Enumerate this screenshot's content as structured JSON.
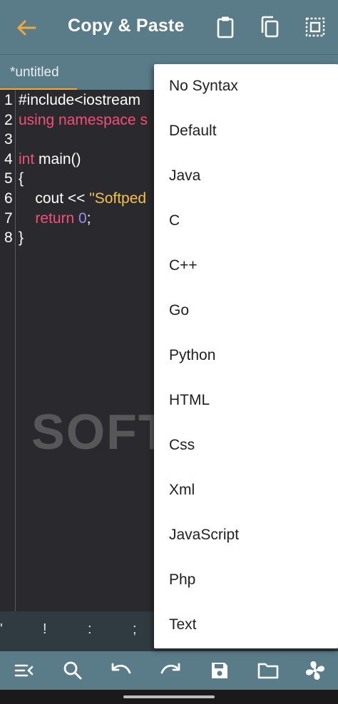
{
  "toolbar": {
    "title": "Copy & Paste",
    "icons": [
      "back-arrow-icon",
      "clipboard-icon",
      "copy-icon",
      "select-all-icon"
    ],
    "accent": "#f2a93b",
    "background": "#5a7c88"
  },
  "tab": {
    "label": "*untitled"
  },
  "editor": {
    "lines": [
      {
        "n": "1",
        "parts": [
          {
            "t": "#include<iostream",
            "c": "plain"
          }
        ]
      },
      {
        "n": "2",
        "parts": [
          {
            "t": "using namespace s",
            "c": "kw"
          }
        ]
      },
      {
        "n": "3",
        "parts": []
      },
      {
        "n": "4",
        "parts": [
          {
            "t": "int",
            "c": "kw"
          },
          {
            "t": " main()",
            "c": "plain"
          }
        ]
      },
      {
        "n": "5",
        "parts": [
          {
            "t": "{",
            "c": "plain"
          }
        ]
      },
      {
        "n": "6",
        "parts": [
          {
            "t": "    cout << ",
            "c": "plain"
          },
          {
            "t": "\"Softped",
            "c": "str"
          }
        ]
      },
      {
        "n": "7",
        "parts": [
          {
            "t": "    return",
            "c": "kw"
          },
          {
            "t": " ",
            "c": "plain"
          },
          {
            "t": "0",
            "c": "num"
          },
          {
            "t": ";",
            "c": "plain"
          }
        ]
      },
      {
        "n": "8",
        "parts": [
          {
            "t": "}",
            "c": "plain"
          }
        ]
      }
    ],
    "watermark": "SOFTPEDIA"
  },
  "symbols": [
    "'",
    "!",
    ":",
    ";"
  ],
  "menu": {
    "items": [
      "No Syntax",
      "Default",
      "Java",
      "C",
      "C++",
      "Go",
      "Python",
      "HTML",
      "Css",
      "Xml",
      "JavaScript",
      "Php",
      "Text"
    ]
  },
  "actionbar": {
    "icons": [
      "menu-collapse-icon",
      "search-icon",
      "undo-icon",
      "redo-icon",
      "save-icon",
      "folder-icon",
      "fan-icon"
    ]
  }
}
